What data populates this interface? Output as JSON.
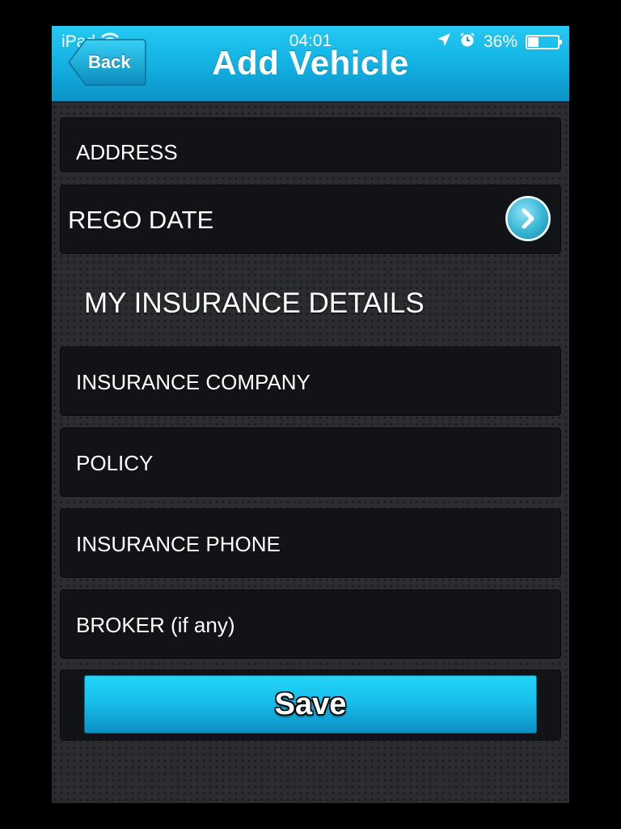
{
  "status_bar": {
    "device": "iPad",
    "time": "04:01",
    "battery": "36%",
    "battery_level": 0.36,
    "icons": [
      "wifi-icon",
      "location-arrow-icon",
      "alarm-icon",
      "battery-icon"
    ]
  },
  "nav": {
    "back_label": "Back",
    "title": "Add Vehicle"
  },
  "form": {
    "address_label": "ADDRESS",
    "rego_date_label": "REGO DATE",
    "insurance_section_title": "MY INSURANCE DETAILS",
    "insurance_company_label": "INSURANCE COMPANY",
    "policy_label": "POLICY",
    "insurance_phone_label": "INSURANCE PHONE",
    "broker_label": "BROKER (if any)"
  },
  "actions": {
    "save_label": "Save"
  },
  "colors": {
    "accent": "#14b4e5",
    "background": "#2b2c2f",
    "row_background": "#121316",
    "text": "#ffffff"
  }
}
